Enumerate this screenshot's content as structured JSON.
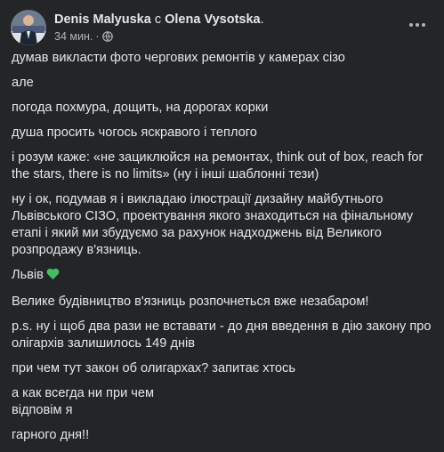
{
  "post": {
    "author": "Denis Malyuska",
    "with_word": " с ",
    "tagged": "Olena Vysotska",
    "name_end": ".",
    "time": "34 мин.",
    "dot": "·",
    "privacy_icon": "globe-icon",
    "more_icon": "more-dots-icon",
    "heart_icon": "green-heart-emoji",
    "accent_color": "#45bd62",
    "paragraphs": [
      "думав викласти фото чергових ремонтів у камерах сізо",
      "але",
      "погода похмура, дощить, на дорогах корки",
      "душа просить чогось яскравого і теплого",
      "і розум каже: «не зациклюйся на ремонтах, think out of box, reach for the stars, there is no limits» (ну і інші шаблонні тези)",
      "ну і ок, подумав я і викладаю ілюстрації дизайну майбутнього Львівського СІЗО, проектування якого знаходиться на фінальному етапі і який ми збудуємо за рахунок надходжень від Великого розпродажу в'язниць.",
      "Львів",
      "Велике будівництво в'язниць розпочнеться вже незабаром!",
      "p.s. ну і щоб два рази не вставати - до дня введення в дію закону про олігархів залишилось 149 днів",
      "при чем тут закон об олигархах? запитає хтось",
      "а как всегда ни при чем",
      "відповім я",
      "гарного дня!!"
    ]
  }
}
